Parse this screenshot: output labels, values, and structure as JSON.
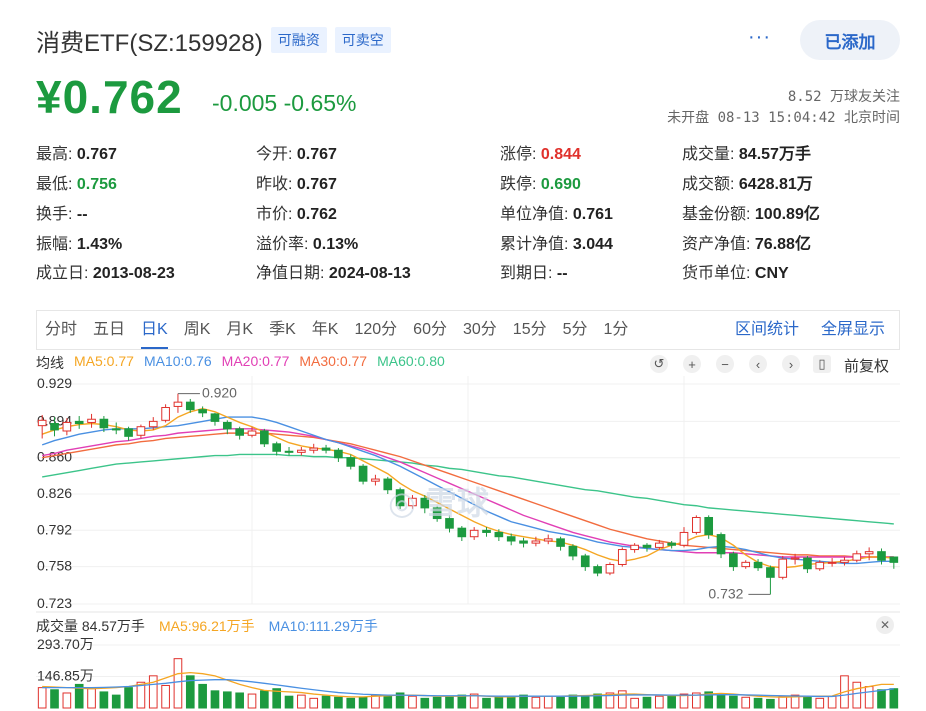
{
  "header": {
    "name": "消费ETF(SZ:159928)",
    "tag1": "可融资",
    "tag2": "可卖空",
    "more": "···",
    "added_button": "已添加"
  },
  "price": {
    "current": "¥0.762",
    "change": "-0.005 -0.65%",
    "followers": "8.52 万球友关注",
    "status": "未开盘 08-13 15:04:42 北京时间"
  },
  "quote": {
    "high_l": "最高:",
    "high_v": "0.767",
    "open_l": "今开:",
    "open_v": "0.767",
    "limitup_l": "涨停:",
    "limitup_v": "0.844",
    "vol_l": "成交量:",
    "vol_v": "84.57万手",
    "low_l": "最低:",
    "low_v": "0.756",
    "prev_l": "昨收:",
    "prev_v": "0.767",
    "limitdn_l": "跌停:",
    "limitdn_v": "0.690",
    "amt_l": "成交额:",
    "amt_v": "6428.81万",
    "turn_l": "换手:",
    "turn_v": "--",
    "mkt_l": "市价:",
    "mkt_v": "0.762",
    "unav_l": "单位净值:",
    "unav_v": "0.761",
    "share_l": "基金份额:",
    "share_v": "100.89亿",
    "amp_l": "振幅:",
    "amp_v": "1.43%",
    "prem_l": "溢价率:",
    "prem_v": "0.13%",
    "cnav_l": "累计净值:",
    "cnav_v": "3.044",
    "asset_l": "资产净值:",
    "asset_v": "76.88亿",
    "est_l": "成立日:",
    "est_v": "2013-08-23",
    "navd_l": "净值日期:",
    "navd_v": "2024-08-13",
    "exp_l": "到期日:",
    "exp_v": "--",
    "cur_l": "货币单位:",
    "cur_v": "CNY"
  },
  "tabs": [
    "分时",
    "五日",
    "日K",
    "周K",
    "月K",
    "季K",
    "年K",
    "120分",
    "60分",
    "30分",
    "15分",
    "5分",
    "1分"
  ],
  "tabs_right": {
    "interval": "区间统计",
    "fullscreen": "全屏显示"
  },
  "ma": {
    "label": "均线",
    "ma5": "MA5:0.77",
    "ma10": "MA10:0.76",
    "ma20": "MA20:0.77",
    "ma30": "MA30:0.77",
    "ma60": "MA60:0.80",
    "restore": "前复权"
  },
  "colors": {
    "up": "#e0312c",
    "down": "#1c9a3f",
    "ma5": "#f5a623",
    "ma10": "#4a90e2",
    "ma20": "#e13fb5",
    "ma30": "#f26c3f",
    "ma60": "#3cc48a",
    "accent": "#2b68c9"
  },
  "chart_data": {
    "type": "candlestick",
    "y_ticks": [
      "0.929",
      "0.894",
      "0.860",
      "0.826",
      "0.792",
      "0.758",
      "0.723"
    ],
    "ylim": [
      0.723,
      0.929
    ],
    "annotation_high": "0.920",
    "annotation_low": "0.732",
    "candles": [
      [
        0.89,
        0.895,
        0.878,
        0.9
      ],
      [
        0.892,
        0.886,
        0.88,
        0.898
      ],
      [
        0.885,
        0.893,
        0.881,
        0.897
      ],
      [
        0.894,
        0.892,
        0.887,
        0.899
      ],
      [
        0.893,
        0.896,
        0.888,
        0.901
      ],
      [
        0.896,
        0.888,
        0.884,
        0.899
      ],
      [
        0.887,
        0.886,
        0.882,
        0.893
      ],
      [
        0.887,
        0.88,
        0.876,
        0.889
      ],
      [
        0.881,
        0.889,
        0.878,
        0.891
      ],
      [
        0.889,
        0.894,
        0.886,
        0.898
      ],
      [
        0.895,
        0.907,
        0.893,
        0.91
      ],
      [
        0.908,
        0.912,
        0.902,
        0.92
      ],
      [
        0.912,
        0.905,
        0.902,
        0.915
      ],
      [
        0.905,
        0.902,
        0.898,
        0.908
      ],
      [
        0.901,
        0.894,
        0.89,
        0.902
      ],
      [
        0.893,
        0.887,
        0.882,
        0.895
      ],
      [
        0.887,
        0.881,
        0.877,
        0.889
      ],
      [
        0.881,
        0.885,
        0.879,
        0.889
      ],
      [
        0.885,
        0.873,
        0.87,
        0.887
      ],
      [
        0.873,
        0.866,
        0.862,
        0.875
      ],
      [
        0.866,
        0.865,
        0.862,
        0.87
      ],
      [
        0.865,
        0.867,
        0.862,
        0.87
      ],
      [
        0.867,
        0.869,
        0.864,
        0.873
      ],
      [
        0.869,
        0.867,
        0.864,
        0.872
      ],
      [
        0.867,
        0.86,
        0.856,
        0.869
      ],
      [
        0.86,
        0.852,
        0.849,
        0.863
      ],
      [
        0.852,
        0.838,
        0.835,
        0.854
      ],
      [
        0.838,
        0.84,
        0.834,
        0.844
      ],
      [
        0.84,
        0.83,
        0.826,
        0.842
      ],
      [
        0.83,
        0.815,
        0.812,
        0.832
      ],
      [
        0.815,
        0.822,
        0.812,
        0.825
      ],
      [
        0.822,
        0.813,
        0.808,
        0.825
      ],
      [
        0.813,
        0.803,
        0.8,
        0.815
      ],
      [
        0.803,
        0.794,
        0.79,
        0.806
      ],
      [
        0.794,
        0.786,
        0.782,
        0.796
      ],
      [
        0.786,
        0.792,
        0.783,
        0.795
      ],
      [
        0.792,
        0.79,
        0.786,
        0.795
      ],
      [
        0.79,
        0.786,
        0.782,
        0.793
      ],
      [
        0.786,
        0.782,
        0.778,
        0.789
      ],
      [
        0.782,
        0.78,
        0.776,
        0.785
      ],
      [
        0.78,
        0.782,
        0.777,
        0.786
      ],
      [
        0.782,
        0.784,
        0.779,
        0.788
      ],
      [
        0.784,
        0.777,
        0.773,
        0.786
      ],
      [
        0.777,
        0.768,
        0.764,
        0.779
      ],
      [
        0.768,
        0.758,
        0.754,
        0.77
      ],
      [
        0.758,
        0.752,
        0.749,
        0.76
      ],
      [
        0.752,
        0.76,
        0.75,
        0.762
      ],
      [
        0.76,
        0.774,
        0.758,
        0.776
      ],
      [
        0.774,
        0.778,
        0.771,
        0.78
      ],
      [
        0.778,
        0.776,
        0.772,
        0.78
      ],
      [
        0.776,
        0.78,
        0.774,
        0.783
      ],
      [
        0.78,
        0.778,
        0.775,
        0.782
      ],
      [
        0.778,
        0.79,
        0.776,
        0.795
      ],
      [
        0.79,
        0.804,
        0.788,
        0.806
      ],
      [
        0.804,
        0.788,
        0.784,
        0.806
      ],
      [
        0.788,
        0.77,
        0.766,
        0.79
      ],
      [
        0.77,
        0.758,
        0.754,
        0.772
      ],
      [
        0.758,
        0.762,
        0.756,
        0.764
      ],
      [
        0.762,
        0.757,
        0.754,
        0.765
      ],
      [
        0.757,
        0.748,
        0.732,
        0.759
      ],
      [
        0.748,
        0.765,
        0.746,
        0.768
      ],
      [
        0.765,
        0.766,
        0.76,
        0.77
      ],
      [
        0.766,
        0.756,
        0.752,
        0.768
      ],
      [
        0.756,
        0.762,
        0.754,
        0.764
      ],
      [
        0.762,
        0.762,
        0.758,
        0.766
      ],
      [
        0.762,
        0.764,
        0.759,
        0.767
      ],
      [
        0.764,
        0.77,
        0.762,
        0.773
      ],
      [
        0.77,
        0.772,
        0.764,
        0.776
      ],
      [
        0.772,
        0.764,
        0.76,
        0.775
      ],
      [
        0.767,
        0.762,
        0.756,
        0.767
      ]
    ],
    "ma5": [
      0.882,
      0.886,
      0.889,
      0.891,
      0.892,
      0.891,
      0.889,
      0.886,
      0.885,
      0.886,
      0.89,
      0.898,
      0.903,
      0.906,
      0.903,
      0.898,
      0.893,
      0.889,
      0.884,
      0.879,
      0.874,
      0.871,
      0.869,
      0.868,
      0.866,
      0.863,
      0.857,
      0.851,
      0.845,
      0.836,
      0.829,
      0.824,
      0.818,
      0.812,
      0.806,
      0.8,
      0.795,
      0.791,
      0.788,
      0.786,
      0.784,
      0.782,
      0.781,
      0.778,
      0.774,
      0.769,
      0.765,
      0.763,
      0.765,
      0.768,
      0.774,
      0.778,
      0.781,
      0.786,
      0.788,
      0.785,
      0.778,
      0.769,
      0.762,
      0.758,
      0.757,
      0.758,
      0.76,
      0.761,
      0.762,
      0.763,
      0.765,
      0.767,
      0.767,
      0.766
    ],
    "ma10": [
      0.872,
      0.876,
      0.879,
      0.882,
      0.884,
      0.886,
      0.887,
      0.887,
      0.887,
      0.888,
      0.889,
      0.89,
      0.892,
      0.894,
      0.896,
      0.898,
      0.898,
      0.898,
      0.896,
      0.893,
      0.889,
      0.885,
      0.881,
      0.877,
      0.874,
      0.87,
      0.866,
      0.862,
      0.857,
      0.852,
      0.846,
      0.84,
      0.834,
      0.828,
      0.822,
      0.816,
      0.81,
      0.805,
      0.8,
      0.797,
      0.794,
      0.791,
      0.789,
      0.787,
      0.784,
      0.781,
      0.779,
      0.777,
      0.776,
      0.775,
      0.774,
      0.773,
      0.773,
      0.774,
      0.776,
      0.777,
      0.776,
      0.774,
      0.771,
      0.768,
      0.766,
      0.765,
      0.764,
      0.763,
      0.762,
      0.761,
      0.761,
      0.762,
      0.763,
      0.763
    ],
    "ma20": [
      0.862,
      0.864,
      0.867,
      0.869,
      0.871,
      0.873,
      0.875,
      0.876,
      0.878,
      0.88,
      0.881,
      0.883,
      0.884,
      0.885,
      0.886,
      0.887,
      0.887,
      0.887,
      0.886,
      0.885,
      0.884,
      0.882,
      0.88,
      0.877,
      0.874,
      0.871,
      0.868,
      0.864,
      0.86,
      0.856,
      0.851,
      0.846,
      0.841,
      0.836,
      0.831,
      0.826,
      0.821,
      0.816,
      0.811,
      0.806,
      0.802,
      0.798,
      0.794,
      0.79,
      0.787,
      0.784,
      0.781,
      0.779,
      0.777,
      0.775,
      0.774,
      0.773,
      0.772,
      0.771,
      0.771,
      0.771,
      0.771,
      0.77,
      0.769,
      0.768,
      0.767,
      0.767,
      0.767,
      0.767,
      0.767,
      0.767,
      0.767,
      0.767,
      0.767,
      0.767
    ],
    "ma30": [
      0.86,
      0.862,
      0.864,
      0.866,
      0.868,
      0.87,
      0.872,
      0.873,
      0.875,
      0.876,
      0.878,
      0.879,
      0.88,
      0.881,
      0.882,
      0.883,
      0.883,
      0.883,
      0.883,
      0.882,
      0.881,
      0.88,
      0.879,
      0.877,
      0.875,
      0.873,
      0.87,
      0.867,
      0.864,
      0.861,
      0.857,
      0.853,
      0.849,
      0.845,
      0.841,
      0.837,
      0.833,
      0.829,
      0.825,
      0.821,
      0.817,
      0.813,
      0.809,
      0.805,
      0.801,
      0.797,
      0.793,
      0.79,
      0.787,
      0.784,
      0.782,
      0.78,
      0.778,
      0.777,
      0.776,
      0.775,
      0.774,
      0.773,
      0.772,
      0.771,
      0.77,
      0.769,
      0.769,
      0.768,
      0.768,
      0.768,
      0.767,
      0.767,
      0.767,
      0.767
    ],
    "ma60": [
      0.842,
      0.844,
      0.846,
      0.848,
      0.85,
      0.852,
      0.854,
      0.855,
      0.856,
      0.857,
      0.858,
      0.859,
      0.86,
      0.861,
      0.862,
      0.862,
      0.863,
      0.863,
      0.863,
      0.863,
      0.862,
      0.862,
      0.861,
      0.861,
      0.86,
      0.86,
      0.859,
      0.858,
      0.857,
      0.856,
      0.855,
      0.853,
      0.852,
      0.85,
      0.849,
      0.847,
      0.845,
      0.843,
      0.842,
      0.84,
      0.838,
      0.836,
      0.834,
      0.832,
      0.83,
      0.829,
      0.827,
      0.825,
      0.823,
      0.822,
      0.82,
      0.818,
      0.816,
      0.815,
      0.813,
      0.812,
      0.811,
      0.81,
      0.809,
      0.808,
      0.807,
      0.806,
      0.805,
      0.804,
      0.803,
      0.802,
      0.801,
      0.8,
      0.799,
      0.798
    ],
    "volume": {
      "label": "成交量",
      "current": "84.57万手",
      "ma5": "MA5:96.21万手",
      "ma10": "MA10:111.29万手",
      "y_ticks": [
        "293.70万",
        "146.85万"
      ],
      "ylim": [
        0,
        293.7
      ],
      "values": [
        95,
        85,
        70,
        110,
        90,
        75,
        60,
        95,
        120,
        150,
        105,
        230,
        150,
        110,
        80,
        75,
        70,
        65,
        80,
        90,
        55,
        60,
        45,
        55,
        50,
        45,
        50,
        60,
        60,
        70,
        55,
        45,
        50,
        55,
        60,
        65,
        45,
        50,
        55,
        60,
        50,
        55,
        50,
        60,
        55,
        65,
        70,
        80,
        45,
        50,
        55,
        60,
        65,
        70,
        75,
        60,
        55,
        50,
        45,
        40,
        55,
        60,
        50,
        45,
        55,
        150,
        120,
        100,
        85,
        90
      ],
      "ma5_values": [
        100,
        98,
        95,
        92,
        90,
        92,
        95,
        100,
        110,
        120,
        140,
        160,
        165,
        160,
        150,
        130,
        110,
        95,
        82,
        78,
        75,
        72,
        65,
        60,
        55,
        52,
        52,
        55,
        57,
        60,
        60,
        58,
        55,
        55,
        55,
        58,
        55,
        52,
        52,
        55,
        55,
        55,
        55,
        57,
        58,
        60,
        62,
        65,
        65,
        62,
        60,
        58,
        58,
        60,
        65,
        68,
        65,
        60,
        55,
        52,
        50,
        52,
        54,
        55,
        56,
        75,
        90,
        100,
        110,
        110
      ],
      "ma10_values": [
        95,
        95,
        95,
        95,
        95,
        96,
        98,
        100,
        105,
        110,
        115,
        122,
        128,
        130,
        132,
        132,
        128,
        122,
        115,
        108,
        100,
        92,
        85,
        78,
        72,
        68,
        64,
        62,
        60,
        60,
        59,
        58,
        57,
        57,
        57,
        57,
        56,
        55,
        55,
        55,
        55,
        55,
        55,
        55,
        56,
        57,
        58,
        60,
        61,
        61,
        61,
        60,
        60,
        60,
        61,
        62,
        62,
        61,
        60,
        58,
        57,
        56,
        55,
        54,
        54,
        60,
        68,
        75,
        82,
        90
      ]
    }
  }
}
